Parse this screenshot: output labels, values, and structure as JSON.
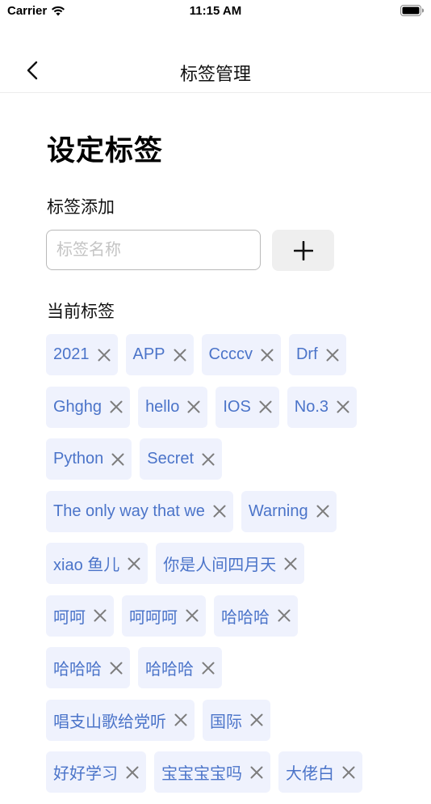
{
  "status_bar": {
    "carrier": "Carrier",
    "time": "11:15 AM"
  },
  "nav": {
    "title": "标签管理"
  },
  "heading": "设定标签",
  "add_section": {
    "label": "标签添加",
    "input_value": "",
    "input_placeholder": "标签名称"
  },
  "current_section": {
    "label": "当前标签"
  },
  "tags": [
    [
      "2021",
      "APP",
      "Ccccv",
      "Drf"
    ],
    [
      "Ghghg",
      "hello",
      "IOS",
      "No.3"
    ],
    [
      "Python",
      "Secret"
    ],
    [
      "The only way that we",
      "Warning"
    ],
    [
      "xiao 鱼儿",
      "你是人间四月天"
    ],
    [
      "呵呵",
      "呵呵呵",
      "哈哈哈"
    ],
    [
      "哈哈哈",
      "哈哈哈"
    ],
    [
      "唱支山歌给党听",
      "国际"
    ],
    [
      "好好学习",
      "宝宝宝宝吗",
      "大佬白"
    ]
  ]
}
